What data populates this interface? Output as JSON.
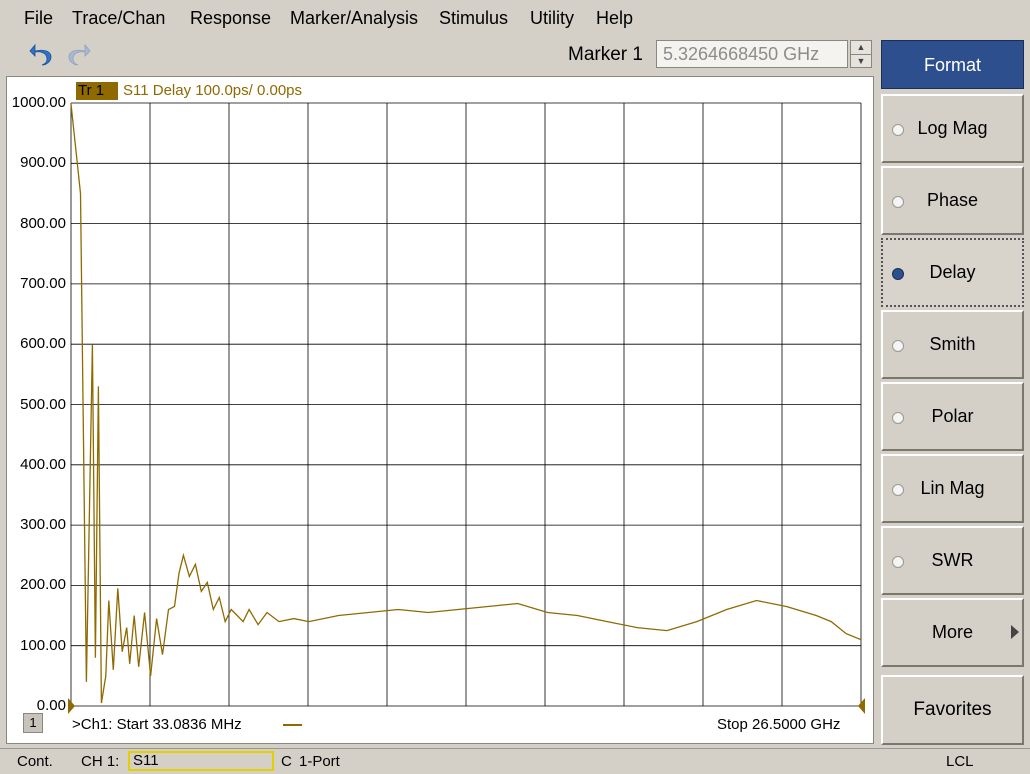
{
  "menu": [
    "File",
    "Trace/Chan",
    "Response",
    "Marker/Analysis",
    "Stimulus",
    "Utility",
    "Help"
  ],
  "toolbar": {
    "undo_icon": "undo-icon",
    "redo_icon": "redo-icon",
    "marker_label": "Marker 1",
    "marker_value": "5.3264668450 GHz"
  },
  "trace": {
    "tag": "Tr  1",
    "description": "S11 Delay 100.0ps/  0.00ps",
    "color": "#8f6a00"
  },
  "channel": {
    "number": "1",
    "start": ">Ch1:   Start  33.0836 MHz",
    "stop": "Stop  26.5000 GHz"
  },
  "chart_data": {
    "type": "line",
    "title": "",
    "xlabel": "",
    "ylabel": "",
    "xlim": [
      0.0330836,
      26.5
    ],
    "ylim": [
      0,
      1000
    ],
    "grid": true,
    "y_ticks": [
      "1000.00",
      "900.00",
      "800.00",
      "700.00",
      "600.00",
      "500.00",
      "400.00",
      "300.00",
      "200.00",
      "100.00",
      "0.00"
    ],
    "series": [
      {
        "x": [
          0.03,
          0.35,
          0.55,
          0.75,
          0.85,
          0.95,
          1.05,
          1.2,
          1.3,
          1.45,
          1.6,
          1.75,
          1.9,
          2.0,
          2.15,
          2.3,
          2.5,
          2.7,
          2.9,
          3.1,
          3.3,
          3.5,
          3.65,
          3.8,
          4.0,
          4.2,
          4.4,
          4.6,
          4.8,
          5.0,
          5.2,
          5.4,
          5.6,
          5.8,
          6.0,
          6.3,
          6.6,
          7.0,
          7.5,
          8.0,
          9.0,
          10.0,
          11.0,
          12.0,
          13.0,
          14.0,
          15.0,
          16.0,
          17.0,
          18.0,
          19.0,
          20.0,
          21.0,
          22.0,
          23.0,
          24.0,
          25.0,
          25.5,
          26.0,
          26.5
        ],
        "y": [
          1000,
          850,
          40,
          600,
          80,
          530,
          5,
          50,
          175,
          60,
          195,
          90,
          130,
          70,
          150,
          65,
          155,
          50,
          145,
          85,
          160,
          165,
          220,
          250,
          215,
          235,
          190,
          205,
          160,
          180,
          140,
          160,
          150,
          140,
          160,
          135,
          155,
          140,
          145,
          140,
          150,
          155,
          160,
          155,
          160,
          165,
          170,
          155,
          150,
          140,
          130,
          125,
          140,
          160,
          175,
          165,
          150,
          140,
          120,
          110
        ]
      }
    ]
  },
  "softkeys": {
    "title": "Format",
    "items": [
      {
        "label": "Log Mag",
        "selected": false
      },
      {
        "label": "Phase",
        "selected": false
      },
      {
        "label": "Delay",
        "selected": true
      },
      {
        "label": "Smith",
        "selected": false
      },
      {
        "label": "Polar",
        "selected": false
      },
      {
        "label": "Lin Mag",
        "selected": false
      },
      {
        "label": "SWR",
        "selected": false
      },
      {
        "label": "More",
        "selected": false
      }
    ],
    "favorites": "Favorites"
  },
  "status": {
    "mode": "Cont.",
    "channel": "CH 1:",
    "measurement": "S11",
    "cal": "C",
    "port": "1-Port",
    "lcl": "LCL"
  }
}
